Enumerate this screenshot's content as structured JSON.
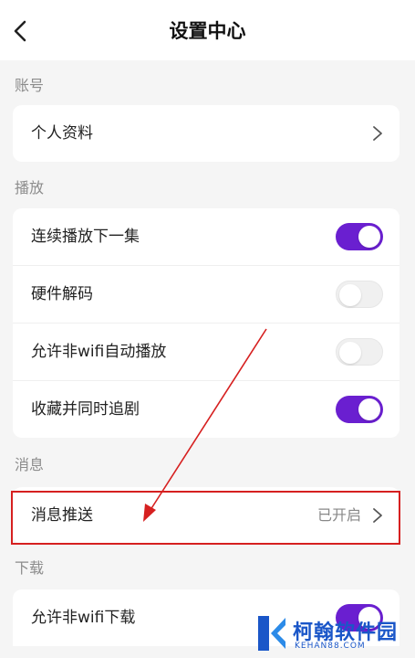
{
  "header": {
    "title": "设置中心"
  },
  "sections": {
    "account": {
      "label": "账号",
      "items": [
        {
          "label": "个人资料"
        }
      ]
    },
    "playback": {
      "label": "播放",
      "items": [
        {
          "label": "连续播放下一集",
          "toggle": true
        },
        {
          "label": "硬件解码",
          "toggle": false
        },
        {
          "label": "允许非wifi自动播放",
          "toggle": false
        },
        {
          "label": "收藏并同时追剧",
          "toggle": true
        }
      ]
    },
    "message": {
      "label": "消息",
      "items": [
        {
          "label": "消息推送",
          "value": "已开启"
        }
      ]
    },
    "download": {
      "label": "下载",
      "items": [
        {
          "label": "允许非wifi下载",
          "toggle": true
        }
      ]
    }
  },
  "watermark": {
    "name": "柯翰软件园",
    "domain": "KEHAN88.COM"
  },
  "colors": {
    "accent": "#6a1fd0",
    "highlight": "#d62020",
    "watermark": "#1a56c8"
  }
}
